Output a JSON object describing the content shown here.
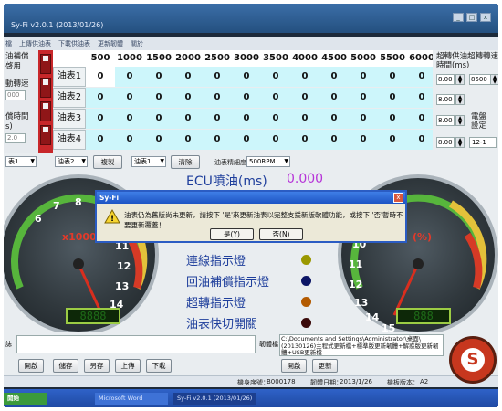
{
  "window": {
    "title": "Sy-Fi v2.0.1 (2013/01/26)"
  },
  "menu": [
    "檔",
    "上傳供油表",
    "下載供油表",
    "更新韌體",
    "關於"
  ],
  "left_panel": {
    "label1": "油補償\n啓用",
    "label2": "動轉速",
    "field2": "000",
    "label3": "償時間\ns)",
    "field3": "2.0"
  },
  "grid": {
    "rpm_headers": [
      "500",
      "1000",
      "1500",
      "2000",
      "2500",
      "3000",
      "3500",
      "4000",
      "4500",
      "5000",
      "5500",
      "6000"
    ],
    "rows": [
      {
        "label": "油表1",
        "values": [
          "0",
          "0",
          "0",
          "0",
          "0",
          "0",
          "0",
          "0",
          "0",
          "0",
          "0",
          "0"
        ]
      },
      {
        "label": "油表2",
        "values": [
          "0",
          "0",
          "0",
          "0",
          "0",
          "0",
          "0",
          "0",
          "0",
          "0",
          "0",
          "0"
        ]
      },
      {
        "label": "油表3",
        "values": [
          "0",
          "0",
          "0",
          "0",
          "0",
          "0",
          "0",
          "0",
          "0",
          "0",
          "0",
          "0"
        ]
      },
      {
        "label": "油表4",
        "values": [
          "0",
          "0",
          "0",
          "0",
          "0",
          "0",
          "0",
          "0",
          "0",
          "0",
          "0",
          "0"
        ]
      }
    ]
  },
  "right_panel": {
    "label_time": "超轉供油\n時間(ms)",
    "label_rpm": "超轉轉速",
    "rpm_value": "8500",
    "values": [
      "8.00",
      "8.00",
      "8.00",
      "8.00"
    ],
    "label_setting": "電盤\n設定",
    "select_value": "12-1"
  },
  "controls": {
    "dd1": "表1",
    "dd2": "油表2",
    "copy": "複製",
    "dd3": "油表1",
    "clear": "清除",
    "precision_label": "油表精細度",
    "precision_value": "500RPM"
  },
  "ecu": {
    "title": "ECU噴油(ms)",
    "value": "0.000"
  },
  "gauge_left": {
    "ticks": [
      "6",
      "7",
      "8",
      "9",
      "10",
      "11",
      "12",
      "13",
      "14",
      "15"
    ],
    "unit": "x1000 R",
    "lcd": "8888"
  },
  "gauge_right": {
    "ticks": [
      "10",
      "11",
      "12",
      "13",
      "14",
      "15"
    ],
    "unit": "(%)",
    "lcd": "888"
  },
  "indicators": [
    {
      "label": "連線指示燈",
      "color": "#9a9800"
    },
    {
      "label": "回油補償指示燈",
      "color": "#0c1666"
    },
    {
      "label": "超轉指示燈",
      "color": "#b35a00"
    },
    {
      "label": "油表快切開關",
      "color": "#3b0b0b"
    }
  ],
  "bottom": {
    "memo_label": "誌",
    "firmware_label": "韌體檔",
    "path": "C:\\Documents and Settings\\Administrator\\桌面\\(20130126)主程式更新檔+標準版更新韌體+解惑版更新韌體+USB更新檔",
    "buttons_left": [
      "開啟",
      "儲存",
      "另存",
      "上傳",
      "下載"
    ],
    "buttons_right": [
      "開啟",
      "更新"
    ],
    "serial_label": "機身序號：",
    "serial": "B000178",
    "fw_date_label": "韌體日期：",
    "fw_date": "2013/1/26",
    "hw_label": "機板版本：",
    "hw": "A2"
  },
  "dialog": {
    "title": "Sy-Fi",
    "message": "油表仍為舊版尚未更新，請按下 '是'來更新油表以完整支援新版軟體功能，或按下 '否'暫時不要更新覆蓋！",
    "yes": "是(Y)",
    "no": "否(N)"
  },
  "taskbar": [
    "開始",
    "Microsoft Word",
    "Sy-Fi v2.0.1 (2013/01/26)"
  ],
  "logo_letter": "S"
}
